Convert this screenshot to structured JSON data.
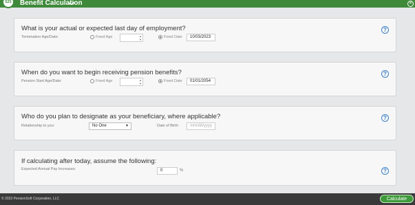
{
  "header": {
    "logo_text": "S2S",
    "title": "Benefit Calculation",
    "chevron": "❯",
    "close": "✕"
  },
  "sections": {
    "employment": {
      "title": "What is your actual or expected last day of employment?",
      "field_label": "Termination Age/Date:",
      "fixed_age_label": "Fixed Age",
      "fixed_date_label": "Fixed Date",
      "date_value": "10/03/2023",
      "selected_option": "Fixed Date"
    },
    "pension_start": {
      "title": "When do you want to begin receiving pension benefits?",
      "field_label": "Pension Start Age/Date:",
      "fixed_age_label": "Fixed Age",
      "fixed_date_label": "Fixed Date",
      "date_value": "01/01/2054",
      "selected_option": "Fixed Date"
    },
    "beneficiary": {
      "title": "Who do you plan to designate as your beneficiary, where applicable?",
      "relationship_label": "Relationship to you:",
      "relationship_value": "No One",
      "dob_label": "Date of Birth:",
      "dob_placeholder": "mm/dd/yyyy"
    },
    "assumptions": {
      "title": "If calculating after today, assume the following:",
      "pay_increase_label": "Expected Annual Pay Increases:",
      "pay_increase_value": "0",
      "pay_increase_unit": "%"
    }
  },
  "help_symbol": "?",
  "footer": {
    "copyright": "© 2023 PensionSoft Corporation, LLC",
    "calculate_label": "Calculate"
  },
  "colors": {
    "brand_green": "#3e8a3a",
    "help_blue": "#3a7fc3",
    "footer_bg": "#3a3a3a"
  }
}
